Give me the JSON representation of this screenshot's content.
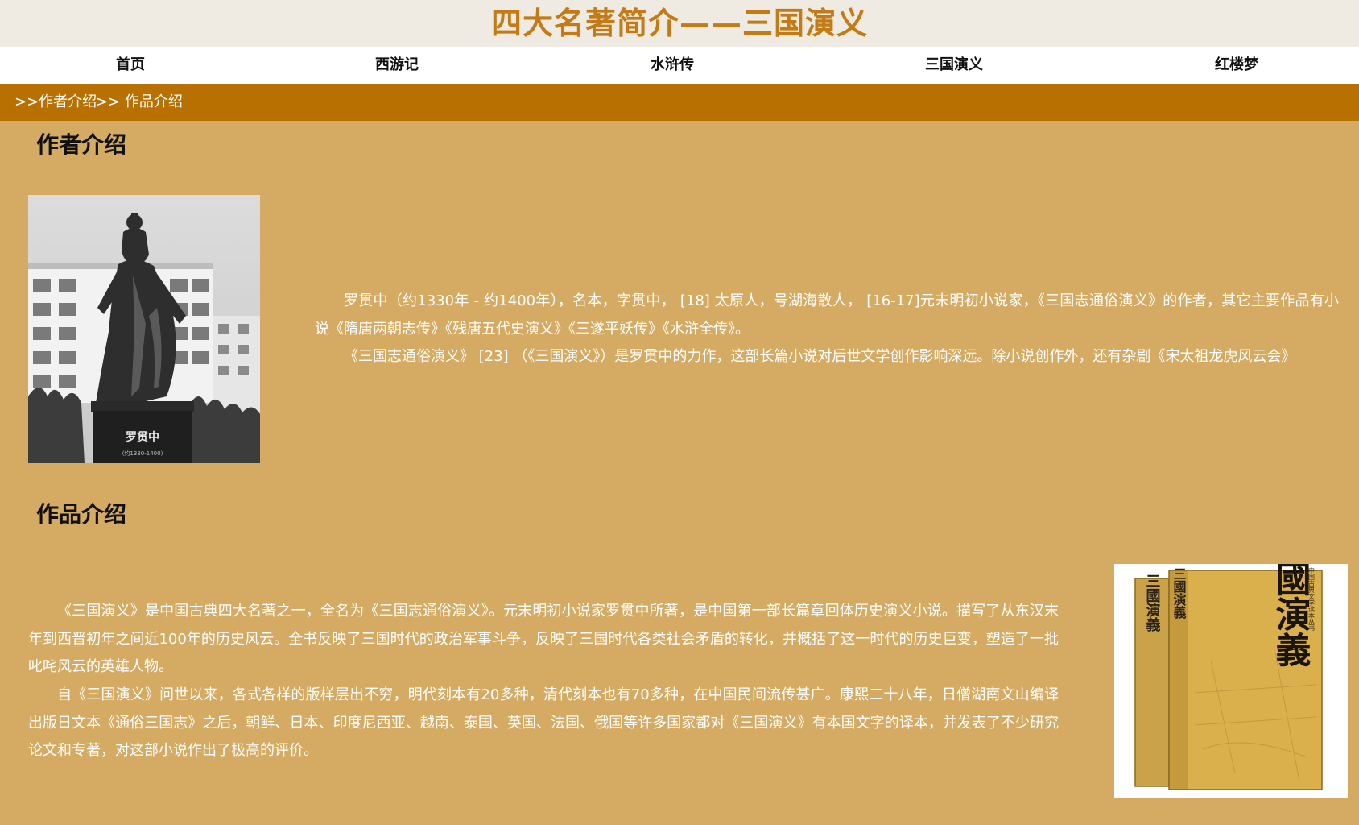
{
  "page": {
    "title": "四大名著简介——三国演义"
  },
  "nav": {
    "items": [
      {
        "label": "首页"
      },
      {
        "label": "西游记"
      },
      {
        "label": "水浒传"
      },
      {
        "label": "三国演义"
      },
      {
        "label": "红楼梦"
      }
    ]
  },
  "breadcrumb": {
    "author_link": ">>作者介绍",
    "works_link": ">> 作品介绍"
  },
  "author_section": {
    "heading": "作者介绍",
    "image_caption": "罗贯中",
    "image_subcaption": "(约1330-1400)",
    "paragraphs": [
      "罗贯中（约1330年 - 约1400年），名本，字贯中， [18] 太原人，号湖海散人， [16-17]元末明初小说家，《三国志通俗演义》的作者，其它主要作品有小说《隋唐两朝志传》《残唐五代史演义》《三遂平妖传》《水浒全传》。",
      "《三国志通俗演义》 [23] （《三国演义》）是罗贯中的力作，这部长篇小说对后世文学创作影响深远。除小说创作外，还有杂剧《宋太祖龙虎风云会》"
    ]
  },
  "works_section": {
    "heading": "作品介绍",
    "image_title": "三國演義",
    "image_spine_title": "三國演義",
    "image_series": "中国古典文学读本丛书",
    "paragraphs": [
      "《三国演义》是中国古典四大名著之一，全名为《三国志通俗演义》。元末明初小说家罗贯中所著，是中国第一部长篇章回体历史演义小说。描写了从东汉末年到西晋初年之间近100年的历史风云。全书反映了三国时代的政治军事斗争，反映了三国时代各类社会矛盾的转化，并概括了这一时代的历史巨变，塑造了一批叱咤风云的英雄人物。",
      "自《三国演义》问世以来，各式各样的版样层出不穷，明代刻本有20多种，清代刻本也有70多种，在中国民间流传甚广。康熙二十八年，日僧湖南文山编译出版日文本《通俗三国志》之后，朝鲜、日本、印度尼西亚、越南、泰国、英国、法国、俄国等许多国家都对《三国演义》有本国文字的译本，并发表了不少研究论文和专著，对这部小说作出了极高的评价。"
    ]
  },
  "colors": {
    "page_background": "#d5ab64",
    "title_bar_background": "#efebe2",
    "title_color": "#c47a15",
    "nav_background": "#ffffff",
    "breadcrumb_background": "#b87000",
    "body_text": "#ffffff",
    "heading_text": "#111111"
  }
}
